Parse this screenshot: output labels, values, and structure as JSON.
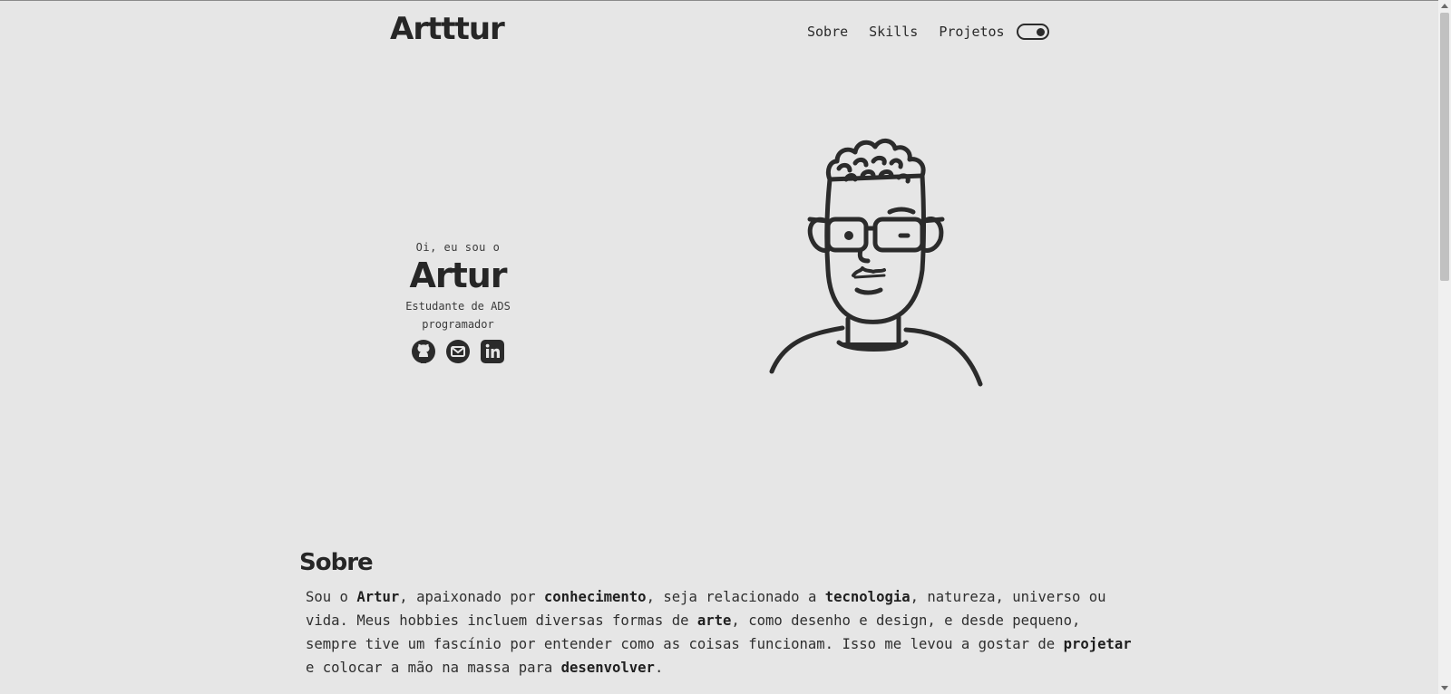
{
  "header": {
    "logo": "Artttur",
    "nav": [
      {
        "label": "Sobre"
      },
      {
        "label": "Skills"
      },
      {
        "label": "Projetos"
      }
    ],
    "theme_toggle_icon": "toggle-switch-icon"
  },
  "hero": {
    "greeting": "Oi, eu sou o",
    "name": "Artur",
    "role_line1": "Estudante de ADS",
    "role_line2": "programador",
    "socials": [
      {
        "icon": "github-icon"
      },
      {
        "icon": "mail-icon"
      },
      {
        "icon": "linkedin-icon"
      }
    ],
    "avatar_icon": "avatar-illustration"
  },
  "about": {
    "title": "Sobre",
    "segments": [
      "Sou o ",
      "Artur",
      ", apaixonado por ",
      "conhecimento",
      ", seja relacionado a ",
      "tecnologia",
      ", natureza, universo ou vida. Meus hobbies incluem diversas formas de ",
      "arte",
      ", como desenho e design, e desde pequeno, sempre tive um fascínio por entender como as coisas funcionam. Isso me levou a gostar de ",
      "projetar",
      " e colocar a mão na massa para ",
      "desenvolver",
      "."
    ]
  },
  "colors": {
    "background": "#e6e6e6",
    "text": "#2b2b2b"
  }
}
